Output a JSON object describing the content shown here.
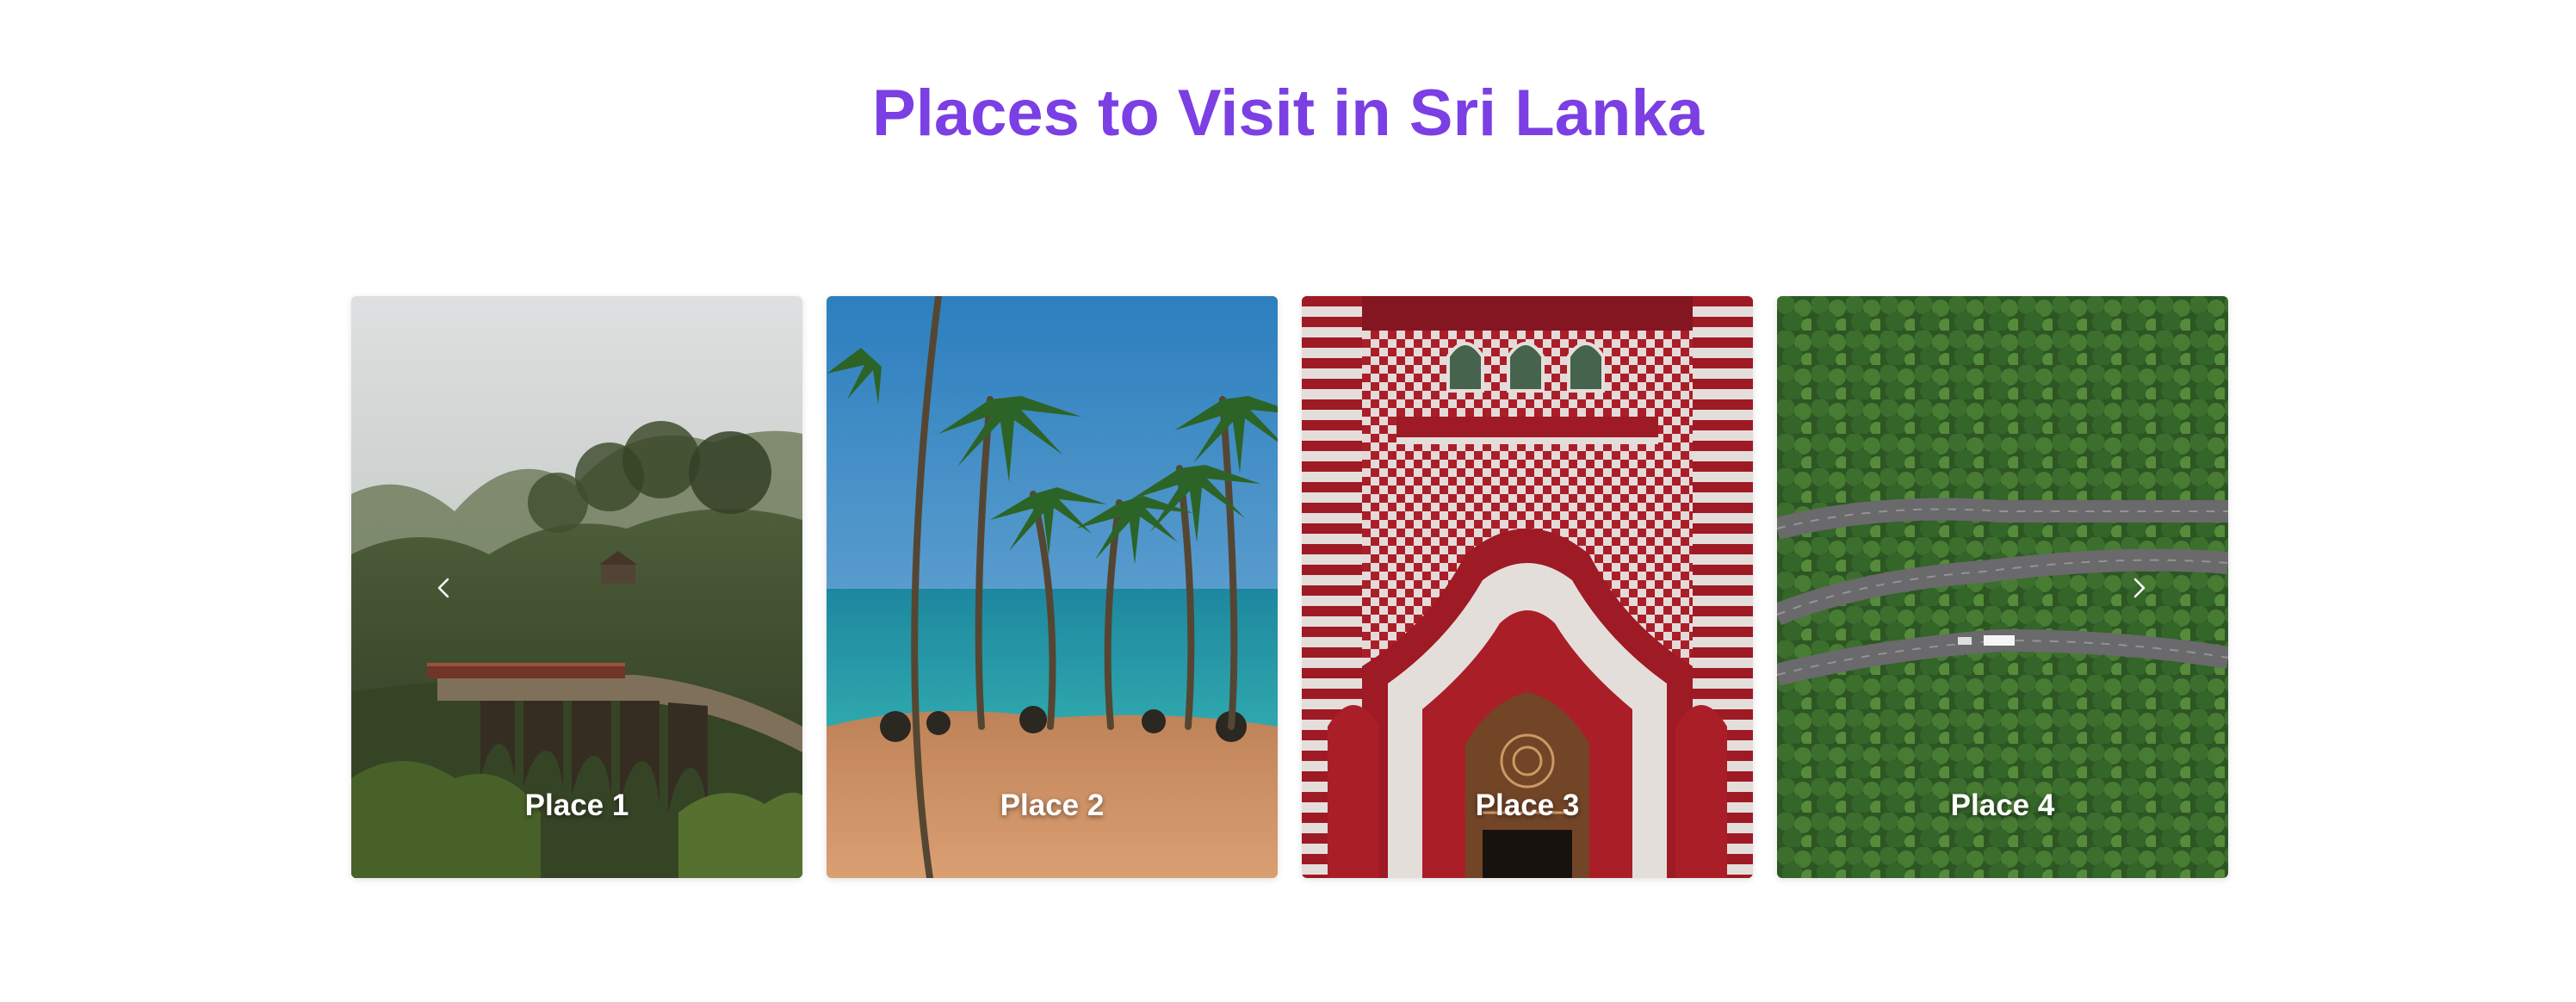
{
  "page": {
    "title": "Places to Visit in Sri Lanka",
    "accent_color": "#7b3fe4"
  },
  "carousel": {
    "prev_icon": "chevron-left-icon",
    "next_icon": "chevron-right-icon",
    "cards": [
      {
        "label": "Place 1",
        "scene": "train crossing arched stone bridge in hills"
      },
      {
        "label": "Place 2",
        "scene": "palm trees on a tropical beach"
      },
      {
        "label": "Place 3",
        "scene": "red and white patterned mosque facade"
      },
      {
        "label": "Place 4",
        "scene": "aerial view of winding road through forest"
      }
    ]
  }
}
